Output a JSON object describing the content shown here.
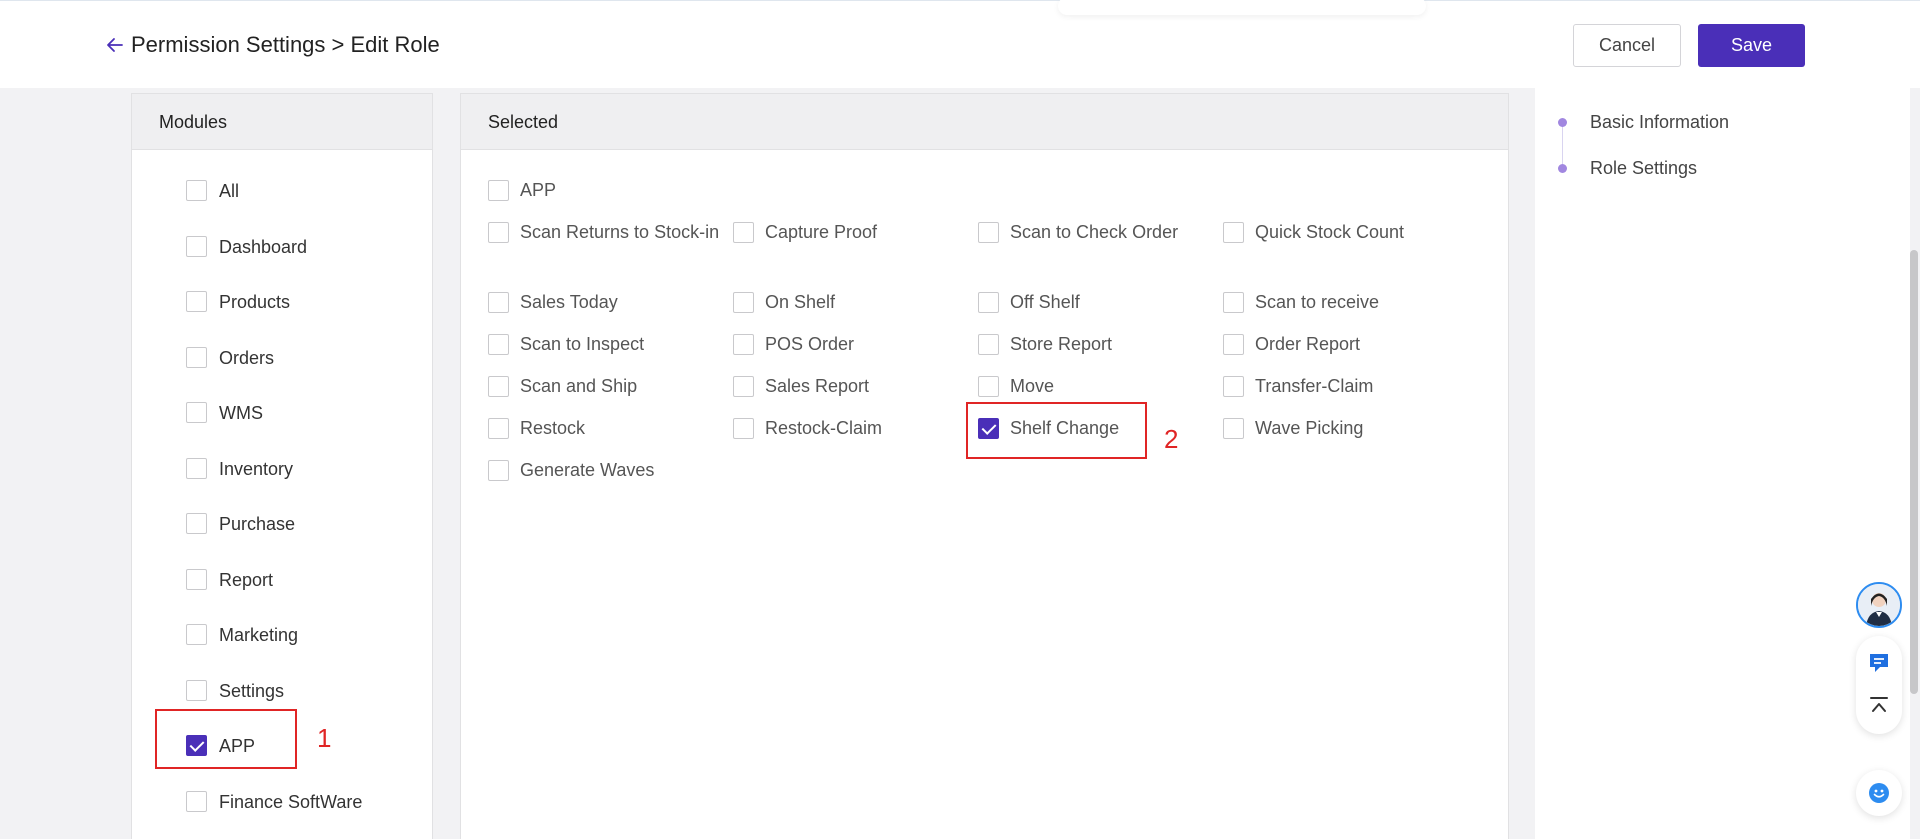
{
  "header": {
    "breadcrumb": "Permission Settings > Edit Role",
    "cancel_label": "Cancel",
    "save_label": "Save"
  },
  "modules": {
    "title": "Modules",
    "items": [
      {
        "label": "All",
        "checked": false
      },
      {
        "label": "Dashboard",
        "checked": false
      },
      {
        "label": "Products",
        "checked": false
      },
      {
        "label": "Orders",
        "checked": false
      },
      {
        "label": "WMS",
        "checked": false
      },
      {
        "label": "Inventory",
        "checked": false
      },
      {
        "label": "Purchase",
        "checked": false
      },
      {
        "label": "Report",
        "checked": false
      },
      {
        "label": "Marketing",
        "checked": false
      },
      {
        "label": "Settings",
        "checked": false
      },
      {
        "label": "APP",
        "checked": true
      },
      {
        "label": "Finance SoftWare",
        "checked": false
      }
    ]
  },
  "selected": {
    "title": "Selected",
    "group_label": "APP",
    "group_checked": false,
    "items": [
      {
        "label": "Scan Returns to Stock-in",
        "checked": false
      },
      {
        "label": "Capture Proof",
        "checked": false
      },
      {
        "label": "Scan to Check Order",
        "checked": false
      },
      {
        "label": "Quick Stock Count",
        "checked": false
      },
      {
        "label": "Sales Today",
        "checked": false
      },
      {
        "label": "On Shelf",
        "checked": false
      },
      {
        "label": "Off Shelf",
        "checked": false
      },
      {
        "label": "Scan to receive",
        "checked": false
      },
      {
        "label": "Scan to Inspect",
        "checked": false
      },
      {
        "label": "POS Order",
        "checked": false
      },
      {
        "label": "Store Report",
        "checked": false
      },
      {
        "label": "Order Report",
        "checked": false
      },
      {
        "label": "Scan and Ship",
        "checked": false
      },
      {
        "label": "Sales Report",
        "checked": false
      },
      {
        "label": "Move",
        "checked": false
      },
      {
        "label": "Transfer-Claim",
        "checked": false
      },
      {
        "label": "Restock",
        "checked": false
      },
      {
        "label": "Restock-Claim",
        "checked": false
      },
      {
        "label": "Shelf Change",
        "checked": true
      },
      {
        "label": "Wave Picking",
        "checked": false
      },
      {
        "label": "Generate Waves",
        "checked": false
      }
    ]
  },
  "annotations": [
    {
      "label": "1"
    },
    {
      "label": "2"
    }
  ],
  "side_nav": {
    "items": [
      "Basic Information",
      "Role Settings"
    ]
  },
  "colors": {
    "accent": "#4a2fb8",
    "annotation": "#e02525",
    "nav_dot": "#a187e0"
  },
  "icons": {
    "back": "arrow-left-icon",
    "chat": "chat-icon",
    "to_top": "back-to-top-icon",
    "bot": "bot-face-icon"
  }
}
